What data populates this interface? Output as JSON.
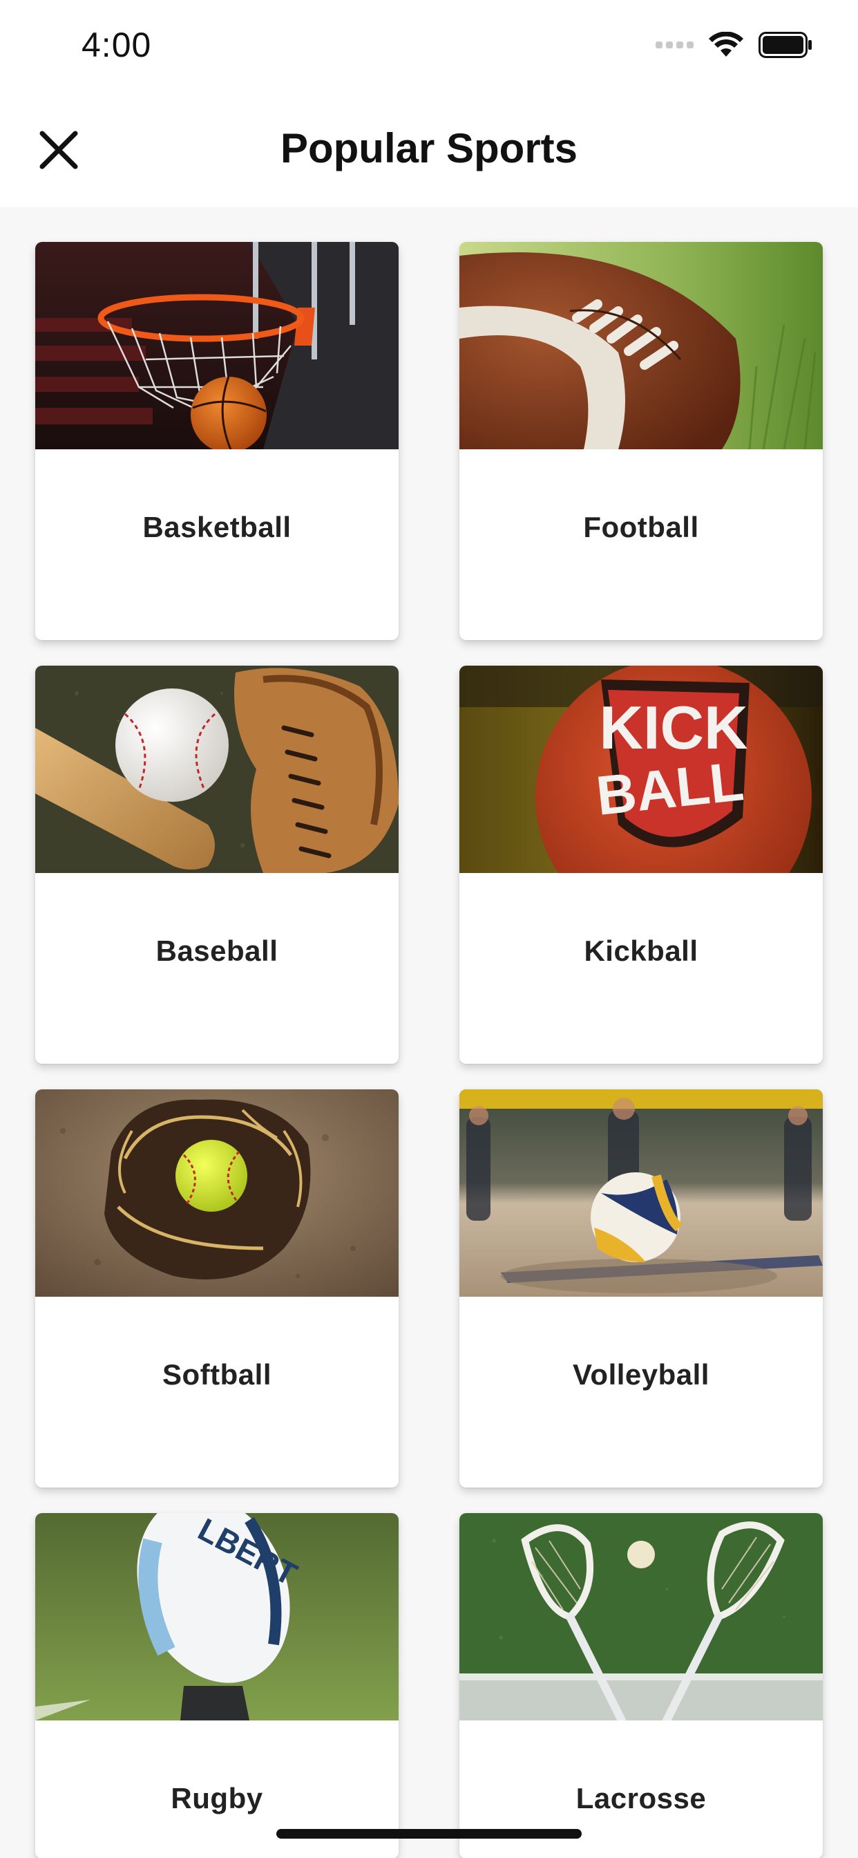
{
  "status_bar": {
    "time": "4:00"
  },
  "nav": {
    "title": "Popular Sports",
    "close_icon": "close-icon"
  },
  "colors": {
    "background": "#f7f7f7",
    "card": "#ffffff",
    "text": "#222222"
  },
  "sports": [
    {
      "label": "Basketball",
      "image": "basketball-hoop-photo"
    },
    {
      "label": "Football",
      "image": "american-football-photo"
    },
    {
      "label": "Baseball",
      "image": "baseball-bat-glove-photo"
    },
    {
      "label": "Kickball",
      "image": "kickball-photo"
    },
    {
      "label": "Softball",
      "image": "softball-glove-photo"
    },
    {
      "label": "Volleyball",
      "image": "beach-volleyball-photo"
    },
    {
      "label": "Rugby",
      "image": "rugby-ball-photo"
    },
    {
      "label": "Lacrosse",
      "image": "lacrosse-sticks-photo"
    }
  ]
}
